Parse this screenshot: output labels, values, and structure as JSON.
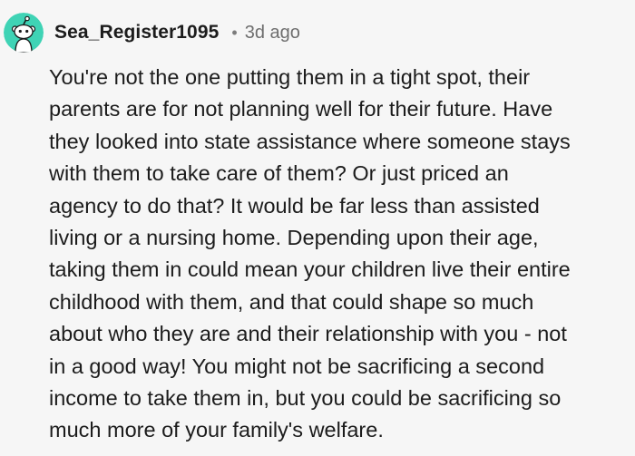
{
  "comment": {
    "author": "Sea_Register1095",
    "separator": "•",
    "timestamp": "3d ago",
    "avatar_icon": "reddit-snoo-avatar-icon",
    "avatar_color": "#3fd3b5",
    "body": "You're not the one putting them in a tight spot, their\nparents are for not planning well for their future. Have\nthey looked into state assistance where someone stays\nwith them to take care of them? Or just priced an\nagency to do that? It would be far less than assisted\nliving or a nursing home. Depending upon their age,\ntaking them in could mean your children live their entire\nchildhood with them, and that could shape so much\nabout who they are and their relationship with you - not\nin a good way! You might not be sacrificing a second\nincome to take them in, but you could be sacrificing so\nmuch more of your family's welfare."
  }
}
